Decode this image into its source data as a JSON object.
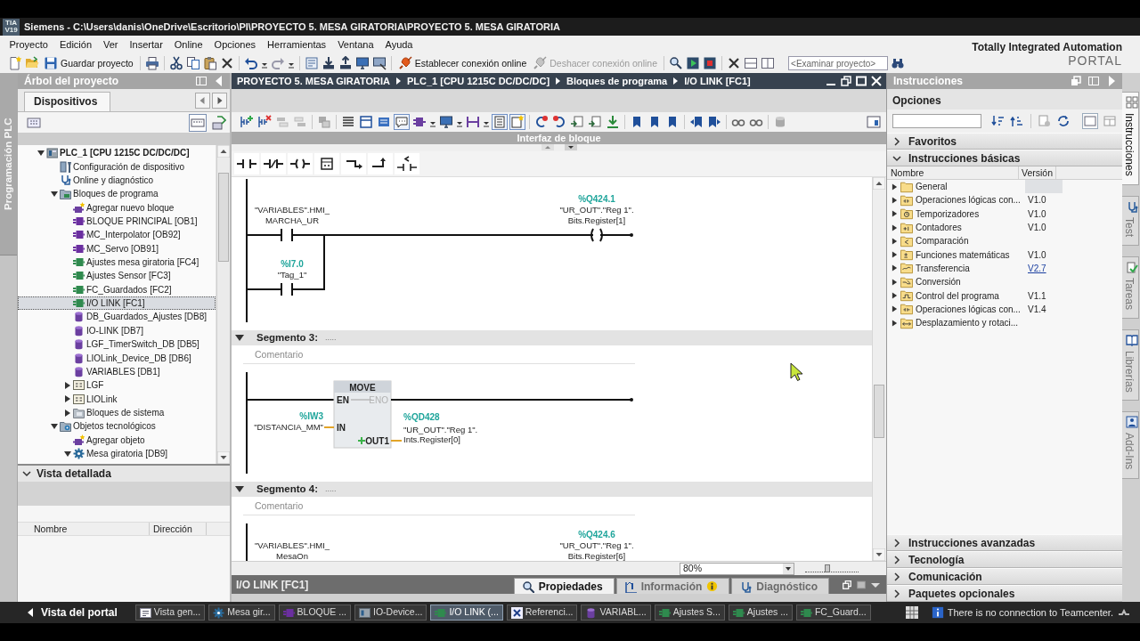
{
  "title_bar": {
    "logo": [
      "TIA",
      "V19"
    ],
    "title": "Siemens - C:\\Users\\danis\\OneDrive\\Escritorio\\PI\\PROYECTO 5. MESA GIRATORIA\\PROYECTO 5. MESA GIRATORIA"
  },
  "menu_bar": [
    {
      "label": "Proyecto"
    },
    {
      "label": "Edición"
    },
    {
      "label": "Ver"
    },
    {
      "label": "Insertar"
    },
    {
      "label": "Online"
    },
    {
      "label": "Opciones"
    },
    {
      "label": "Herramientas"
    },
    {
      "label": "Ventana"
    },
    {
      "label": "Ayuda"
    }
  ],
  "toolbar": {
    "save": {
      "label": "Guardar proyecto"
    },
    "connect_online": {
      "label": "Establecer conexión online",
      "disabled": false
    },
    "disconnect_online": {
      "label": "Deshacer conexión online",
      "disabled": true
    },
    "search": {
      "placeholder": "<Examinar proyecto>"
    }
  },
  "brand": {
    "line_1": "Totally Integrated Automation",
    "line_2": "PORTAL"
  },
  "left_strip": {
    "tabs": [
      {
        "label": "Programación PLC",
        "selected": true
      }
    ]
  },
  "project_tree": {
    "title": "Árbol del proyecto",
    "tabs": [
      {
        "label": "Dispositivos",
        "selected": true
      }
    ],
    "view_toggle": {
      "on": true
    },
    "items": [
      {
        "label": "PLC_1 [CPU 1215C DC/DC/DC]",
        "kind": "plc",
        "expanded": true,
        "selected": false,
        "children": [
          {
            "label": "Configuración de dispositivo",
            "kind": "config",
            "selected": false
          },
          {
            "label": "Online y diagnóstico",
            "kind": "online",
            "selected": false
          },
          {
            "label": "Bloques de programa",
            "kind": "folder",
            "expanded": true,
            "selected": false,
            "children": [
              {
                "label": "Agregar nuevo bloque",
                "kind": "add",
                "selected": false
              },
              {
                "label": "BLOQUE PRINCIPAL [OB1]",
                "kind": "ob",
                "selected": false
              },
              {
                "label": "MC_Interpolator [OB92]",
                "kind": "ob",
                "selected": false
              },
              {
                "label": "MC_Servo [OB91]",
                "kind": "ob",
                "selected": false
              },
              {
                "label": "Ajustes mesa giratoria [FC4]",
                "kind": "fc",
                "selected": false
              },
              {
                "label": "Ajustes Sensor [FC3]",
                "kind": "fc",
                "selected": false
              },
              {
                "label": "FC_Guardados [FC2]",
                "kind": "fc",
                "selected": false
              },
              {
                "label": "I/O LINK [FC1]",
                "kind": "fc",
                "selected": true
              },
              {
                "label": "DB_Guardados_Ajustes [DB8]",
                "kind": "db",
                "selected": false
              },
              {
                "label": "IO-LINK [DB7]",
                "kind": "db",
                "selected": false
              },
              {
                "label": "LGF_TimerSwitch_DB [DB5]",
                "kind": "db",
                "selected": false
              },
              {
                "label": "LIOLink_Device_DB [DB6]",
                "kind": "db",
                "selected": false
              },
              {
                "label": "VARIABLES [DB1]",
                "kind": "db",
                "selected": false
              },
              {
                "label": "LGF",
                "kind": "group",
                "expanded": false,
                "selected": false
              },
              {
                "label": "LIOLink",
                "kind": "group",
                "expanded": false,
                "selected": false
              },
              {
                "label": "Bloques de sistema",
                "kind": "system",
                "expanded": false,
                "selected": false
              }
            ]
          },
          {
            "label": "Objetos tecnológicos",
            "kind": "technology",
            "expanded": true,
            "selected": false,
            "children": [
              {
                "label": "Agregar objeto",
                "kind": "add",
                "selected": false
              },
              {
                "label": "Mesa giratoria [DB9]",
                "kind": "axis",
                "expanded": true,
                "selected": false
              }
            ]
          }
        ]
      }
    ]
  },
  "detail_view": {
    "title": "Vista detallada",
    "expanded": true,
    "columns": [
      {
        "label": "Nombre"
      },
      {
        "label": "Dirección"
      }
    ]
  },
  "editor": {
    "breadcrumb": [
      "PROYECTO 5. MESA GIRATORIA",
      "PLC_1 [CPU 1215C DC/DC/DC]",
      "Bloques de programa",
      "I/O LINK [FC1]"
    ],
    "toolbar_toggles": [
      {
        "on": true
      },
      {
        "on": true
      },
      {
        "on": true
      }
    ],
    "interface_bar": {
      "label": "Interfaz de bloque"
    },
    "networks": [
      {
        "kind": "or_contacts_coil",
        "contacts": [
          {
            "operand": [
              "\"VARIABLES\".HMI_",
              "MARCHA_UR"
            ]
          },
          {
            "address": "%I7.0",
            "operand": [
              "\"Tag_1\""
            ]
          }
        ],
        "coil": {
          "address": "%Q424.1",
          "operand": [
            "\"UR_OUT\".\"Reg 1\".",
            "Bits.Register[1]"
          ]
        }
      },
      {
        "kind": "move_box",
        "header": {
          "label": "Segmento 3:",
          "title": ".....",
          "expanded": true
        },
        "comment": {
          "placeholder": "Comentario"
        },
        "box": {
          "title": "MOVE",
          "pins": [
            {
              "label": "EN",
              "dimmed": false
            },
            {
              "label": "ENO",
              "dimmed": true
            },
            {
              "label": "IN",
              "dimmed": false
            },
            {
              "label": "OUT1",
              "dimmed": false
            }
          ],
          "input": {
            "address": "%IW3",
            "operand": [
              "\"DISTANCIA_MM\""
            ]
          },
          "output": {
            "address": "%QD428",
            "operand": [
              "\"UR_OUT\".\"Reg 1\".",
              "Ints.Register[0]"
            ]
          }
        }
      },
      {
        "kind": "contact_coil",
        "header": {
          "label": "Segmento 4:",
          "title": ".....",
          "expanded": true
        },
        "comment": {
          "placeholder": "Comentario"
        },
        "contacts": [
          {
            "operand": [
              "\"VARIABLES\".HMI_",
              "MesaOn"
            ]
          }
        ],
        "coil": {
          "address": "%Q424.6",
          "operand": [
            "\"UR_OUT\".\"Reg 1\".",
            "Bits.Register[6]"
          ]
        }
      }
    ],
    "zoom": {
      "value": "80%",
      "level": 0.4
    }
  },
  "inspector": {
    "title": "I/O LINK [FC1]",
    "tabs": [
      {
        "label": "Propiedades",
        "selected": true,
        "notice": false
      },
      {
        "label": "Información",
        "selected": false,
        "notice": true
      },
      {
        "label": "Diagnóstico",
        "selected": false,
        "notice": false
      }
    ]
  },
  "instructions": {
    "title": "Instrucciones",
    "options": {
      "label": "Opciones"
    },
    "sections": [
      {
        "label": "Favoritos",
        "expanded": false
      },
      {
        "label": "Instrucciones básicas",
        "expanded": true,
        "columns": [
          {
            "label": "Nombre"
          },
          {
            "label": "Versión"
          }
        ],
        "rows": [
          {
            "name": "General",
            "selected": true
          },
          {
            "name": "Operaciones lógicas con...",
            "version": "V1.0",
            "link": false,
            "selected": false
          },
          {
            "name": "Temporizadores",
            "version": "V1.0",
            "link": false,
            "selected": false
          },
          {
            "name": "Contadores",
            "version": "V1.0",
            "link": false,
            "selected": false
          },
          {
            "name": "Comparación",
            "selected": false
          },
          {
            "name": "Funciones matemáticas",
            "version": "V1.0",
            "link": false,
            "selected": false
          },
          {
            "name": "Transferencia",
            "version": "V2.7",
            "link": true,
            "selected": false
          },
          {
            "name": "Conversión",
            "selected": false
          },
          {
            "name": "Control del programa",
            "version": "V1.1",
            "link": false,
            "selected": false
          },
          {
            "name": "Operaciones lógicas con...",
            "version": "V1.4",
            "link": false,
            "selected": false
          },
          {
            "name": "Desplazamiento y rotaci...",
            "selected": false
          }
        ]
      },
      {
        "label": "Instrucciones avanzadas",
        "expanded": false
      },
      {
        "label": "Tecnología",
        "expanded": false
      },
      {
        "label": "Comunicación",
        "expanded": false
      },
      {
        "label": "Paquetes opcionales",
        "expanded": false
      }
    ]
  },
  "side_tabs": [
    {
      "label": "Instrucciones",
      "selected": true
    },
    {
      "label": "Test",
      "selected": false
    },
    {
      "label": "Tareas",
      "selected": false
    },
    {
      "label": "Librerías",
      "selected": false
    },
    {
      "label": "Add-Ins",
      "selected": false
    }
  ],
  "taskbar": {
    "portal": {
      "label": "Vista del portal"
    },
    "items": [
      {
        "label": "Vista gen...",
        "kind": "overview",
        "selected": false
      },
      {
        "label": "Mesa gir...",
        "kind": "axis",
        "selected": false
      },
      {
        "label": "BLOQUE ...",
        "kind": "ob",
        "selected": false
      },
      {
        "label": "IO-Device...",
        "kind": "device",
        "selected": false
      },
      {
        "label": "I/O LINK (...",
        "kind": "fc",
        "selected": true
      },
      {
        "label": "Referenci...",
        "kind": "xref",
        "selected": false
      },
      {
        "label": "VARIABL...",
        "kind": "db",
        "selected": false
      },
      {
        "label": "Ajustes S...",
        "kind": "fc",
        "selected": false
      },
      {
        "label": "Ajustes ...",
        "kind": "fc",
        "selected": false
      },
      {
        "label": "FC_Guard...",
        "kind": "fc",
        "selected": false
      }
    ],
    "status": "There is no connection to Teamcenter."
  }
}
